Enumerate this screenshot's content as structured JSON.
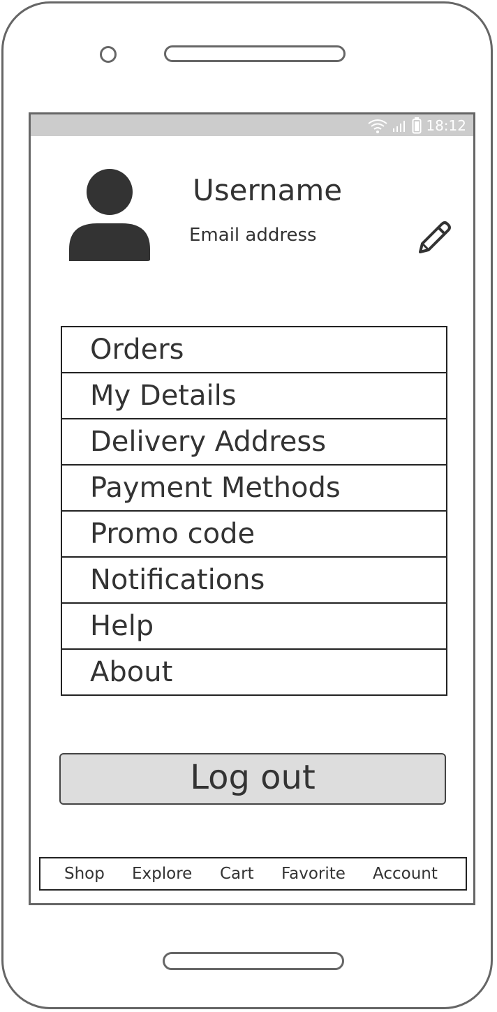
{
  "status_bar": {
    "time": "18:12",
    "icons": [
      "wifi-icon",
      "signal-icon",
      "battery-icon"
    ]
  },
  "profile": {
    "username": "Username",
    "email": "Email address",
    "avatar_icon": "user-avatar-icon",
    "edit_icon": "pencil-icon"
  },
  "menu": {
    "items": [
      {
        "label": "Orders"
      },
      {
        "label": "My Details"
      },
      {
        "label": "Delivery Address"
      },
      {
        "label": "Payment Methods"
      },
      {
        "label": "Promo code"
      },
      {
        "label": "Notifications"
      },
      {
        "label": "Help"
      },
      {
        "label": "About"
      }
    ]
  },
  "logout": {
    "label": "Log out"
  },
  "bottom_nav": {
    "items": [
      {
        "label": "Shop"
      },
      {
        "label": "Explore"
      },
      {
        "label": "Cart"
      },
      {
        "label": "Favorite"
      },
      {
        "label": "Account"
      }
    ]
  },
  "colors": {
    "frame": "#666666",
    "status_bar": "#cccccc",
    "text": "#333333",
    "button_fill": "#dddddd"
  }
}
